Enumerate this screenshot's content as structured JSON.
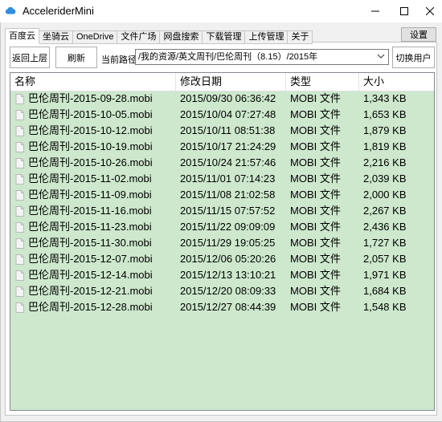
{
  "window": {
    "title": "AcceleriderMini",
    "minimize_glyph": "—",
    "maximize_glyph": "☐",
    "close_glyph": "✕",
    "icon": "cloud-icon"
  },
  "tabs": [
    {
      "label": "百度云",
      "active": true
    },
    {
      "label": "坐骑云",
      "active": false
    },
    {
      "label": "OneDrive",
      "active": false
    },
    {
      "label": "文件广场",
      "active": false
    },
    {
      "label": "网盘搜索",
      "active": false
    },
    {
      "label": "下载管理",
      "active": false
    },
    {
      "label": "上传管理",
      "active": false
    },
    {
      "label": "关于",
      "active": false
    }
  ],
  "settings_label": "设置",
  "toolbar": {
    "up_label": "返回上层",
    "refresh_label": "刷新",
    "path_label": "当前路径",
    "path_value": "/我的资源/英文周刊/巴伦周刊（8.15）/2015年",
    "switch_user_label": "切换用户"
  },
  "list": {
    "columns": [
      "名称",
      "修改日期",
      "类型",
      "大小"
    ],
    "rows": [
      {
        "name": "巴伦周刊-2015-09-28.mobi",
        "date": "2015/09/30 06:36:42",
        "type": "MOBI 文件",
        "size": "1,343 KB"
      },
      {
        "name": "巴伦周刊-2015-10-05.mobi",
        "date": "2015/10/04 07:27:48",
        "type": "MOBI 文件",
        "size": "1,653 KB"
      },
      {
        "name": "巴伦周刊-2015-10-12.mobi",
        "date": "2015/10/11 08:51:38",
        "type": "MOBI 文件",
        "size": "1,879 KB"
      },
      {
        "name": "巴伦周刊-2015-10-19.mobi",
        "date": "2015/10/17 21:24:29",
        "type": "MOBI 文件",
        "size": "1,819 KB"
      },
      {
        "name": "巴伦周刊-2015-10-26.mobi",
        "date": "2015/10/24 21:57:46",
        "type": "MOBI 文件",
        "size": "2,216 KB"
      },
      {
        "name": "巴伦周刊-2015-11-02.mobi",
        "date": "2015/11/01 07:14:23",
        "type": "MOBI 文件",
        "size": "2,039 KB"
      },
      {
        "name": "巴伦周刊-2015-11-09.mobi",
        "date": "2015/11/08 21:02:58",
        "type": "MOBI 文件",
        "size": "2,000 KB"
      },
      {
        "name": "巴伦周刊-2015-11-16.mobi",
        "date": "2015/11/15 07:57:52",
        "type": "MOBI 文件",
        "size": "2,267 KB"
      },
      {
        "name": "巴伦周刊-2015-11-23.mobi",
        "date": "2015/11/22 09:09:09",
        "type": "MOBI 文件",
        "size": "2,436 KB"
      },
      {
        "name": "巴伦周刊-2015-11-30.mobi",
        "date": "2015/11/29 19:05:25",
        "type": "MOBI 文件",
        "size": "1,727 KB"
      },
      {
        "name": "巴伦周刊-2015-12-07.mobi",
        "date": "2015/12/06 05:20:26",
        "type": "MOBI 文件",
        "size": "2,057 KB"
      },
      {
        "name": "巴伦周刊-2015-12-14.mobi",
        "date": "2015/12/13 13:10:21",
        "type": "MOBI 文件",
        "size": "1,971 KB"
      },
      {
        "name": "巴伦周刊-2015-12-21.mobi",
        "date": "2015/12/20 08:09:33",
        "type": "MOBI 文件",
        "size": "1,684 KB"
      },
      {
        "name": "巴伦周刊-2015-12-28.mobi",
        "date": "2015/12/27 08:44:39",
        "type": "MOBI 文件",
        "size": "1,548 KB"
      }
    ]
  },
  "colors": {
    "selection_background": "#cde8cd",
    "app_icon": "#2f8ee0"
  }
}
